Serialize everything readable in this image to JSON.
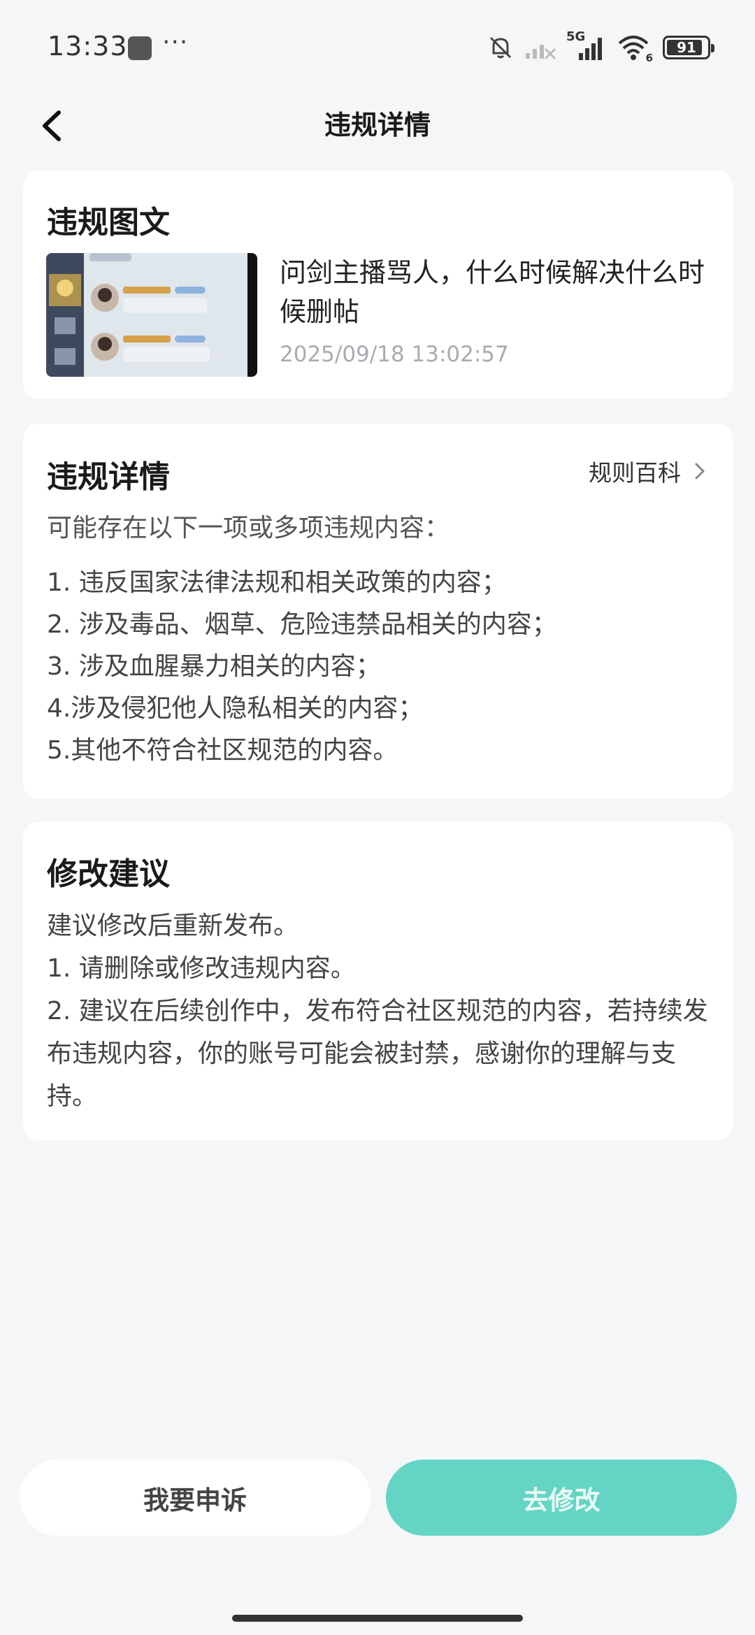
{
  "status_bar": {
    "time": "13:33",
    "more": "···",
    "network_label": "5G",
    "wifi_label": "6",
    "battery": "91",
    "battery_level": 0.91
  },
  "header": {
    "title": "违规详情",
    "back_icon": "chevron-left-icon"
  },
  "violation_post": {
    "section_title": "违规图文",
    "text": "问剑主播骂人，什么时候解决什么时候删帖",
    "timestamp": "2025/09/18 13:02:57"
  },
  "violation_detail": {
    "section_title": "违规详情",
    "rules_link": "规则百科",
    "intro": "可能存在以下一项或多项违规内容：",
    "items": [
      "1. 违反国家法律法规和相关政策的内容；",
      "2. 涉及毒品、烟草、危险违禁品相关的内容；",
      "3. 涉及血腥暴力相关的内容；",
      "4.涉及侵犯他人隐私相关的内容；",
      "5.其他不符合社区规范的内容。"
    ]
  },
  "suggestion": {
    "section_title": "修改建议",
    "lines": [
      "建议修改后重新发布。",
      "1. 请删除或修改违规内容。",
      "2. 建议在后续创作中，发布符合社区规范的内容，若持续发布违规内容，你的账号可能会被封禁，感谢你的理解与支持。"
    ]
  },
  "actions": {
    "appeal": "我要申诉",
    "modify": "去修改"
  },
  "colors": {
    "accent": "#64d5c4",
    "background": "#f5f6f8"
  }
}
